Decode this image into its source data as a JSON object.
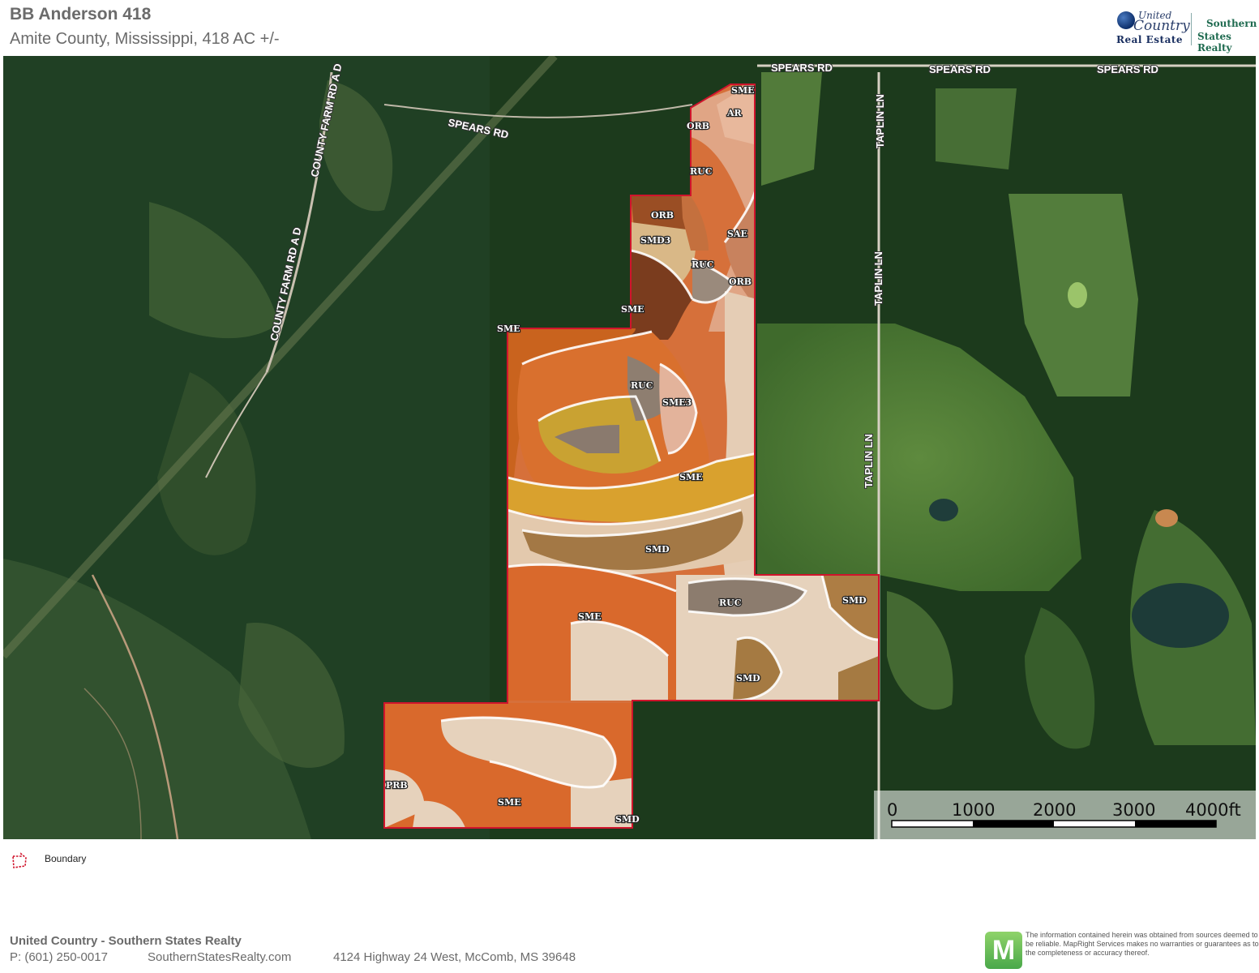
{
  "header": {
    "title": "BB Anderson 418",
    "subtitle": "Amite County, Mississippi, 418 AC +/-"
  },
  "logo": {
    "united": "United",
    "country": "Country",
    "real_estate": "Real Estate",
    "southern": "Southern",
    "states_realty": "States Realty"
  },
  "map": {
    "roads": {
      "spears_1": "SPEARS RD",
      "spears_2": "SPEARS RD",
      "spears_3": "SPEARS RD",
      "spears_4": "SPEARS RD",
      "county_farm_1": "COUNTY FARM RD A D",
      "county_farm_2": "COUNTY FARM RD A D",
      "taplin_1": "TAPLIN LN",
      "taplin_2": "TAPLIN LN",
      "taplin_3": "TAPLIN LN"
    },
    "soil_labels": {
      "sme_n": "SME",
      "ar": "AR",
      "orb_1": "ORB",
      "ruc_1": "RUC",
      "orb_2": "ORB",
      "smd3": "SMD3",
      "sae": "SAE",
      "ruc_2": "RUC",
      "orb_3": "ORB",
      "sme_2": "SME",
      "sme_3": "SME",
      "ruc_3": "RUC",
      "sme3": "SME3",
      "sme_4": "SME",
      "smd_1": "SMD",
      "ruc_4": "RUC",
      "smd_2": "SMD",
      "sme_5": "SME",
      "smd_3": "SMD",
      "prb": "PRB",
      "sme_6": "SME",
      "smd_4": "SMD"
    },
    "scale": {
      "ticks": [
        "0",
        "1000",
        "2000",
        "3000",
        "4000ft"
      ]
    }
  },
  "legend": {
    "boundary_label": "Boundary",
    "boundary_color": "#d0142c"
  },
  "footer": {
    "company": "United Country - Southern States Realty",
    "phone": "P: (601) 250-0017",
    "website": "SouthernStatesRealty.com",
    "address": "4124 Highway 24 West, McComb, MS 39648",
    "badge": "M",
    "disclaimer": "The information contained herein was obtained from sources deemed to be reliable. MapRight Services makes no warranties or guarantees as to the completeness or accuracy thereof."
  }
}
